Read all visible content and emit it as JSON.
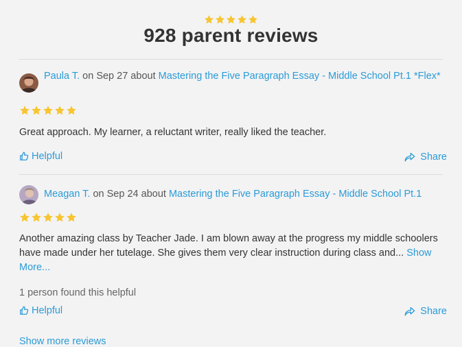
{
  "header": {
    "rating_stars": 5,
    "title": "928 parent reviews"
  },
  "reviews": [
    {
      "author": "Paula T.",
      "date_text": " on Sep 27 about ",
      "class_title": "Mastering the Five Paragraph Essay - Middle School Pt.1 *Flex*",
      "rating": 5,
      "text": "Great approach. My learner, a reluctant writer, really liked the teacher.",
      "helpful_label": "Helpful",
      "share_label": "Share"
    },
    {
      "author": "Meagan T.",
      "date_text": " on Sep 24 about ",
      "class_title": "Mastering the Five Paragraph Essay - Middle School Pt.1",
      "rating": 5,
      "text": "Another amazing class by Teacher Jade.  I am blown away at the progress my middle schoolers have made under her tutelage.  She gives them very clear instruction during class and... ",
      "show_more_label": "Show More...",
      "helpful_count_text": "1 person found this helpful",
      "helpful_label": "Helpful",
      "share_label": "Share"
    }
  ],
  "footer": {
    "show_more_reviews_label": "Show more reviews"
  },
  "colors": {
    "accent": "#2a9bd6",
    "star": "#f7c531",
    "background": "#f3f3f4"
  },
  "icons": [
    "star-icon",
    "thumbs-up-icon",
    "share-icon"
  ]
}
